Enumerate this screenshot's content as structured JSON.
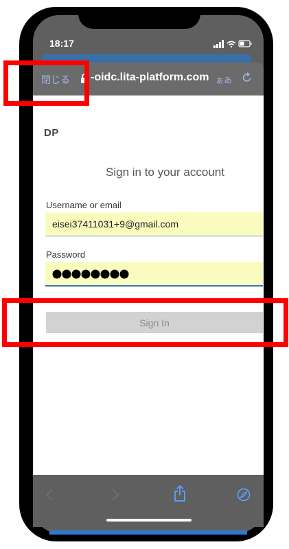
{
  "status_bar": {
    "time": "18:17"
  },
  "browser": {
    "close_label": "閉じる",
    "url": "-oidc.lita-platform.com",
    "text_size_label": "ぁあ"
  },
  "page": {
    "brand": "DP",
    "heading": "Sign in to your account",
    "username_label": "Username or email",
    "username_value": "eisei37411031+9@gmail.com",
    "password_label": "Password",
    "signin_label": "Sign In"
  },
  "colors": {
    "highlight": "#ff0000",
    "input_bg": "#fafcbf",
    "link_blue": "#9cb8e2"
  }
}
